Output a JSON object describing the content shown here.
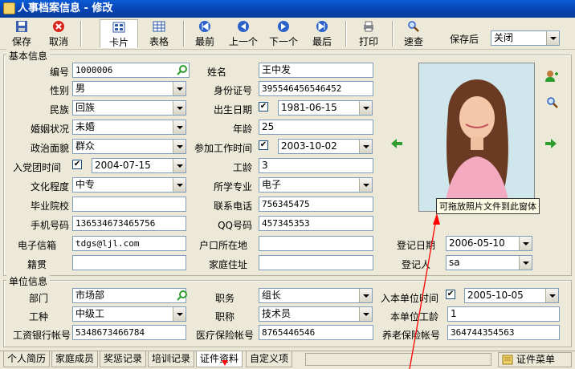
{
  "window": {
    "title": "人事档案信息 - 修改"
  },
  "toolbar": {
    "save": "保存",
    "cancel": "取消",
    "card": "卡片",
    "table": "表格",
    "first": "最前",
    "prev": "上一个",
    "next": "下一个",
    "last": "最后",
    "print": "打印",
    "query": "速查",
    "after_save_label": "保存后",
    "after_save_value": "关闭"
  },
  "basic": {
    "title": "基本信息",
    "id_label": "编号",
    "id": "1000006",
    "name_label": "姓名",
    "name": "王中发",
    "gender_label": "性别",
    "gender": "男",
    "idcard_label": "身份证号",
    "idcard": "395546456546452",
    "ethnic_label": "民族",
    "ethnic": "回族",
    "birth_label": "出生日期",
    "birth": "1981-06-15",
    "marital_label": "婚姻状况",
    "marital": "未婚",
    "age_label": "年龄",
    "age": "25",
    "politics_label": "政治面貌",
    "politics": "群众",
    "work_label": "参加工作时间",
    "work": "2003-10-02",
    "party_label": "入党团时间",
    "party": "2004-07-15",
    "seniority_label": "工龄",
    "seniority": "3",
    "edu_label": "文化程度",
    "edu": "中专",
    "major_label": "所学专业",
    "major": "电子",
    "school_label": "毕业院校",
    "school": "",
    "phone_label": "联系电话",
    "phone": "756345475",
    "mobile_label": "手机号码",
    "mobile": "136534673465756",
    "qq_label": "QQ号码",
    "qq": "457345353",
    "email_label": "电子信箱",
    "email": "tdgs@ljl.com",
    "hukou_label": "户口所在地",
    "hukou": "",
    "origin_label": "籍贯",
    "origin": "",
    "address_label": "家庭住址",
    "address": "",
    "regdate_label": "登记日期",
    "regdate": "2006-05-10",
    "registrar_label": "登记人",
    "registrar": "sa",
    "photo_tip": "可拖放照片文件到此窗体"
  },
  "unit": {
    "title": "单位信息",
    "dept_label": "部门",
    "dept": "市场部",
    "post_label": "职务",
    "post": "组长",
    "join_label": "入本单位时间",
    "join": "2005-10-05",
    "worktype_label": "工种",
    "worktype": "中级工",
    "title_label": "职称",
    "title_val": "技术员",
    "unitage_label": "本单位工龄",
    "unitage": "1",
    "bank_label": "工资银行帐号",
    "bank": "5348673466784",
    "medical_label": "医疗保险帐号",
    "medical": "8765446546",
    "pension_label": "养老保险帐号",
    "pension": "364744354563"
  },
  "tabs": [
    "个人简历",
    "家庭成员",
    "奖惩记录",
    "培训记录",
    "证件资料",
    "自定义项"
  ],
  "cert_menu": "证件菜单",
  "colors": {
    "titlebar": "#0842b0",
    "arrow": "#ff0000",
    "accent_green": "#2e9d2e"
  }
}
